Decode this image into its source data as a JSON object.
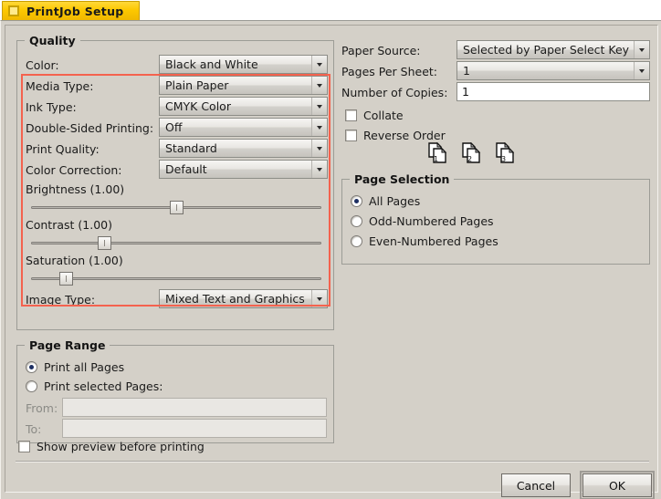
{
  "window": {
    "tab_title": "PrintJob Setup",
    "tab_icon": "window-icon",
    "accent_tab_color": "#fdc800",
    "highlight_color": "#f4624e",
    "face_color": "#d4d0c8"
  },
  "quality": {
    "legend": "Quality",
    "rows": [
      {
        "label": "Color:",
        "value": "Black and White"
      },
      {
        "label": "Media Type:",
        "value": "Plain Paper"
      },
      {
        "label": "Ink Type:",
        "value": "CMYK Color"
      },
      {
        "label": "Double-Sided Printing:",
        "value": "Off"
      },
      {
        "label": "Print Quality:",
        "value": "Standard"
      },
      {
        "label": "Color Correction:",
        "value": "Default"
      }
    ],
    "sliders": [
      {
        "label": "Brightness (1.00)",
        "value": 1.0,
        "percent": 50
      },
      {
        "label": "Contrast (1.00)",
        "value": 1.0,
        "percent": 25
      },
      {
        "label": "Saturation (1.00)",
        "value": 1.0,
        "percent": 12
      }
    ],
    "image_type": {
      "label": "Image Type:",
      "value": "Mixed Text and Graphics"
    }
  },
  "page_range": {
    "legend": "Page Range",
    "options": [
      {
        "label": "Print all Pages",
        "selected": true
      },
      {
        "label": "Print selected Pages:",
        "selected": false
      }
    ],
    "from": {
      "label": "From:",
      "value": "",
      "enabled": false
    },
    "to": {
      "label": "To:",
      "value": "",
      "enabled": false
    }
  },
  "right": {
    "paper_source": {
      "label": "Paper Source:",
      "value": "Selected by Paper Select Key"
    },
    "pages_per_sheet": {
      "label": "Pages Per Sheet:",
      "value": "1"
    },
    "number_of_copies": {
      "label": "Number of Copies:",
      "value": "1"
    },
    "collate": {
      "label": "Collate",
      "checked": false
    },
    "reverse_order": {
      "label": "Reverse Order",
      "checked": false
    },
    "page_icons": [
      "1",
      "2",
      "3"
    ]
  },
  "page_selection": {
    "legend": "Page Selection",
    "options": [
      {
        "label": "All Pages",
        "selected": true
      },
      {
        "label": "Odd-Numbered Pages",
        "selected": false
      },
      {
        "label": "Even-Numbered Pages",
        "selected": false
      }
    ]
  },
  "footer": {
    "show_preview": {
      "label": "Show preview before printing",
      "checked": false
    },
    "cancel_label": "Cancel",
    "ok_label": "OK"
  }
}
